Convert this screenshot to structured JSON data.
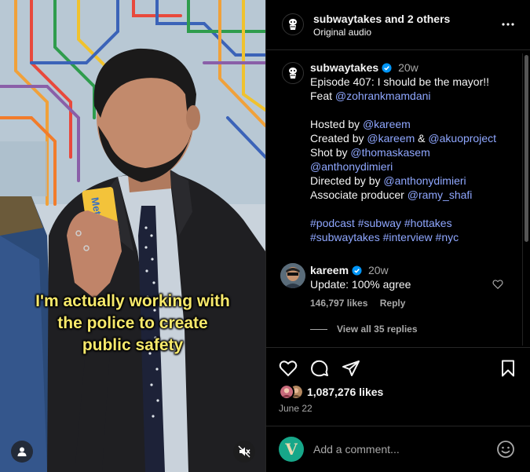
{
  "video": {
    "caption_lines": [
      "I'm actually working with",
      "the police to create",
      "public safety"
    ],
    "card_text": "Metro"
  },
  "header": {
    "username": "subwaytakes",
    "and_others": "and 2 others",
    "subtitle": "Original audio"
  },
  "caption": {
    "username": "subwaytakes",
    "time": "20w",
    "lines": [
      [
        {
          "t": "Episode 407: I should be the mayor!!"
        }
      ],
      [
        {
          "t": "Feat "
        },
        {
          "t": "@zohrankmamdani",
          "link": true
        }
      ],
      [],
      [
        {
          "t": "Hosted by "
        },
        {
          "t": "@kareem",
          "link": true
        }
      ],
      [
        {
          "t": "Created by "
        },
        {
          "t": "@kareem",
          "link": true
        },
        {
          "t": " & "
        },
        {
          "t": "@akuoproject",
          "link": true
        }
      ],
      [
        {
          "t": "Shot by "
        },
        {
          "t": "@thomaskasem",
          "link": true
        }
      ],
      [
        {
          "t": "@anthonydimieri",
          "link": true
        }
      ],
      [
        {
          "t": "Directed by by "
        },
        {
          "t": "@anthonydimieri",
          "link": true
        }
      ],
      [
        {
          "t": "Associate producer "
        },
        {
          "t": "@ramy_shafi",
          "link": true
        }
      ],
      [],
      [
        {
          "t": "#podcast",
          "link": true
        },
        {
          "t": " "
        },
        {
          "t": "#subway",
          "link": true
        },
        {
          "t": " "
        },
        {
          "t": "#hottakes",
          "link": true
        }
      ],
      [
        {
          "t": "#subwaytakes",
          "link": true
        },
        {
          "t": " "
        },
        {
          "t": "#interview",
          "link": true
        },
        {
          "t": " "
        },
        {
          "t": "#nyc",
          "link": true
        }
      ]
    ]
  },
  "comment": {
    "username": "kareem",
    "time": "20w",
    "text": "Update: 100% agree",
    "likes": "146,797 likes",
    "reply_label": "Reply",
    "view_replies": "View all 35 replies"
  },
  "actions": {
    "likes": "1,087,276 likes",
    "date": "June 22"
  },
  "add_comment": {
    "avatar_letter": "V",
    "placeholder": "Add a comment..."
  },
  "colors": {
    "link": "#8fa7ff",
    "verified": "#0095f6",
    "caption_yellow": "#f7e96b"
  },
  "icons": [
    "more-icon",
    "verified-icon",
    "heart-icon",
    "comment-icon",
    "share-icon",
    "bookmark-icon",
    "emoji-icon",
    "mute-icon",
    "user-tag-icon"
  ]
}
